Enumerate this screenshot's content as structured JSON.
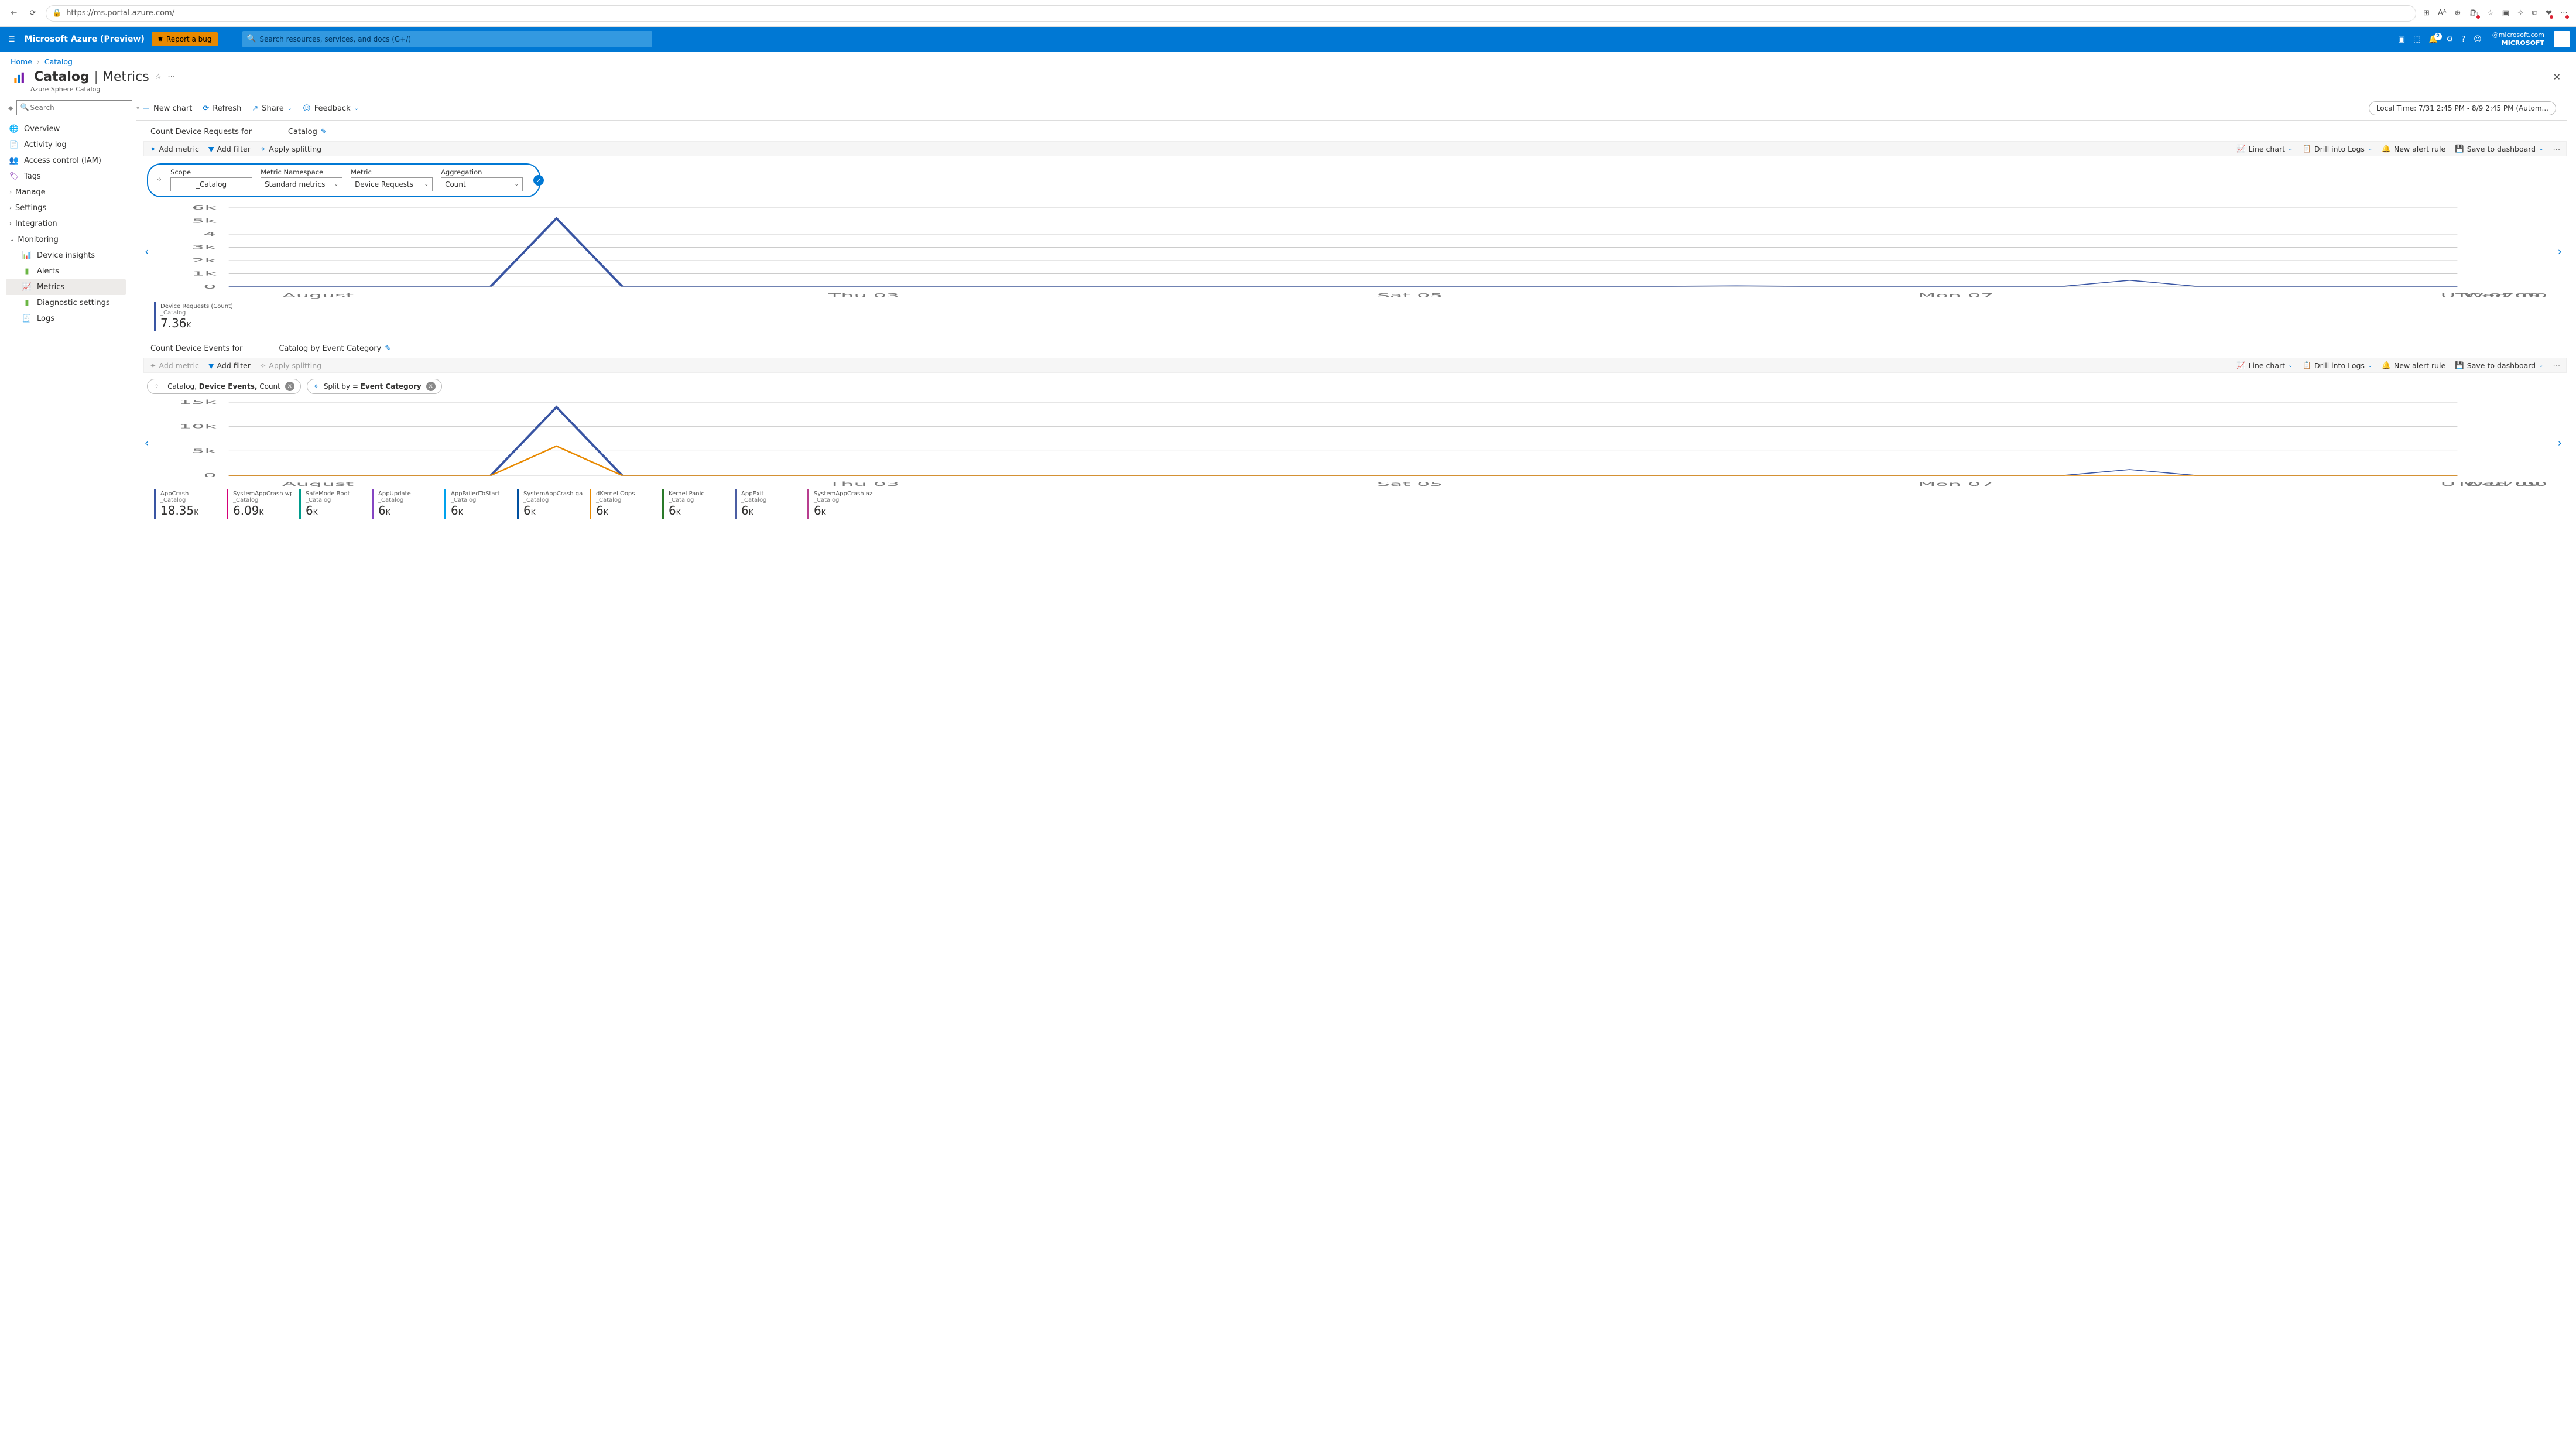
{
  "browser": {
    "url": "https://ms.portal.azure.com/"
  },
  "top": {
    "brand": "Microsoft Azure (Preview)",
    "bug": "Report a bug",
    "search_placeholder": "Search resources, services, and docs (G+/)",
    "notif_badge": "2",
    "user": {
      "email": "@microsoft.com",
      "tenant": "MICROSOFT"
    }
  },
  "crumbs": {
    "home": "Home",
    "current": "Catalog"
  },
  "header": {
    "title": "Catalog",
    "section": "Metrics",
    "subtitle": "Azure Sphere Catalog"
  },
  "sidebar": {
    "search_placeholder": "Search",
    "items": [
      {
        "label": "Overview",
        "icon": "overview"
      },
      {
        "label": "Activity log",
        "icon": "activity"
      },
      {
        "label": "Access control (IAM)",
        "icon": "iam"
      },
      {
        "label": "Tags",
        "icon": "tags"
      }
    ],
    "simple": [
      {
        "label": "Manage"
      },
      {
        "label": "Settings"
      },
      {
        "label": "Integration"
      }
    ],
    "monitoring_label": "Monitoring",
    "monitoring": [
      {
        "label": "Device insights",
        "icon": "insights"
      },
      {
        "label": "Alerts",
        "icon": "alerts"
      },
      {
        "label": "Metrics",
        "icon": "metrics",
        "active": true
      },
      {
        "label": "Diagnostic settings",
        "icon": "diag"
      },
      {
        "label": "Logs",
        "icon": "logs"
      }
    ]
  },
  "maintoolbar": {
    "newchart": "New chart",
    "refresh": "Refresh",
    "share": "Share",
    "feedback": "Feedback",
    "timerange": "Local Time: 7/31 2:45 PM - 8/9 2:45 PM (Autom..."
  },
  "chart1": {
    "title_prefix": "Count Device Requests for",
    "title_suffix": "Catalog",
    "subtoolbar": {
      "addmetric": "Add metric",
      "addfilter": "Add filter",
      "applysplit": "Apply splitting",
      "linechart": "Line chart",
      "drill": "Drill into Logs",
      "newalert": "New alert rule",
      "savedash": "Save to dashboard"
    },
    "selector": {
      "scope_label": "Scope",
      "scope": "_Catalog",
      "ns_label": "Metric Namespace",
      "ns": "Standard metrics",
      "metric_label": "Metric",
      "metric": "Device Requests",
      "agg_label": "Aggregation",
      "agg": "Count"
    },
    "legend": {
      "name": "Device Requests (Count)",
      "scope": "_Catalog",
      "value": "7.36",
      "unit": "K",
      "color": "#3955a3"
    }
  },
  "chart2": {
    "title_prefix": "Count Device Events for",
    "title_suffix": "Catalog by Event Category",
    "subtoolbar": {
      "addmetric": "Add metric",
      "addfilter": "Add filter",
      "applysplit": "Apply splitting",
      "linechart": "Line chart",
      "drill": "Drill into Logs",
      "newalert": "New alert rule",
      "savedash": "Save to dashboard"
    },
    "chips": {
      "metric_scope": "_Catalog,",
      "metric_name": "Device Events,",
      "metric_agg": "Count",
      "split_prefix": "Split by = ",
      "split_val": "Event Category"
    },
    "legend": [
      {
        "name": "AppCrash",
        "scope": "_Catalog",
        "value": "18.35",
        "unit": "K",
        "color": "#3955a3"
      },
      {
        "name": "SystemAppCrash wpa_s...",
        "scope": "_Catalog",
        "value": "6.09",
        "unit": "K",
        "color": "#d40078"
      },
      {
        "name": "SafeMode Boot",
        "scope": "_Catalog",
        "value": "6",
        "unit": "K",
        "color": "#009c8c"
      },
      {
        "name": "AppUpdate",
        "scope": "_Catalog",
        "value": "6",
        "unit": "K",
        "color": "#8546c2"
      },
      {
        "name": "AppFailedToStart",
        "scope": "_Catalog",
        "value": "6",
        "unit": "K",
        "color": "#00a2ed"
      },
      {
        "name": "SystemAppCrash gatewa...",
        "scope": "_Catalog",
        "value": "6",
        "unit": "K",
        "color": "#0050a0"
      },
      {
        "name": "dKernel Oops",
        "scope": "_Catalog",
        "value": "6",
        "unit": "K",
        "color": "#e88900"
      },
      {
        "name": "Kernel Panic",
        "scope": "_Catalog",
        "value": "6",
        "unit": "K",
        "color": "#2a7a2a"
      },
      {
        "name": "AppExit",
        "scope": "_Catalog",
        "value": "6",
        "unit": "K",
        "color": "#4b5ea3"
      },
      {
        "name": "SystemAppCrash azured...",
        "scope": "_Catalog",
        "value": "6",
        "unit": "K",
        "color": "#b83d8f"
      }
    ]
  },
  "chart_data": [
    {
      "type": "line",
      "title": "Device Requests (Count)",
      "ylabel": "",
      "xlabel": "",
      "ylim": [
        0,
        6000
      ],
      "yticks": [
        "0",
        "1k",
        "2k",
        "3k",
        "4",
        "5k",
        "6k"
      ],
      "xticks": [
        "August",
        "Thu 03",
        "Sat 05",
        "Mon 07",
        "Wed 09"
      ],
      "tz": "UTC-07:00",
      "series": [
        {
          "name": "Device Requests",
          "color": "#3955a3",
          "values": [
            50,
            50,
            50,
            50,
            50,
            5200,
            50,
            50,
            50,
            50,
            50,
            50,
            50,
            50,
            50,
            50,
            50,
            50,
            50,
            50,
            50,
            50,
            50,
            80,
            50,
            50,
            50,
            50,
            50,
            500,
            50,
            50,
            50,
            50,
            50
          ]
        }
      ]
    },
    {
      "type": "line",
      "title": "Device Events by Event Category",
      "ylabel": "",
      "xlabel": "",
      "ylim": [
        0,
        15000
      ],
      "yticks": [
        "0",
        "5k",
        "10k",
        "15k"
      ],
      "xticks": [
        "August",
        "Thu 03",
        "Sat 05",
        "Mon 07",
        "Wed 09"
      ],
      "tz": "UTC-07:00",
      "series": [
        {
          "name": "AppCrash",
          "color": "#3955a3",
          "values": [
            0,
            0,
            0,
            0,
            0,
            14000,
            0,
            0,
            0,
            0,
            0,
            0,
            0,
            0,
            0,
            0,
            0,
            0,
            0,
            0,
            0,
            0,
            0,
            0,
            0,
            0,
            0,
            0,
            0,
            1200,
            0,
            0,
            0,
            0,
            0
          ]
        },
        {
          "name": "SystemAppCrash",
          "color": "#e88900",
          "values": [
            0,
            0,
            0,
            0,
            0,
            6000,
            0,
            0,
            0,
            0,
            0,
            0,
            0,
            0,
            0,
            0,
            0,
            0,
            0,
            0,
            0,
            0,
            0,
            0,
            0,
            0,
            0,
            0,
            0,
            0,
            0,
            0,
            0,
            0,
            0
          ]
        }
      ]
    }
  ]
}
